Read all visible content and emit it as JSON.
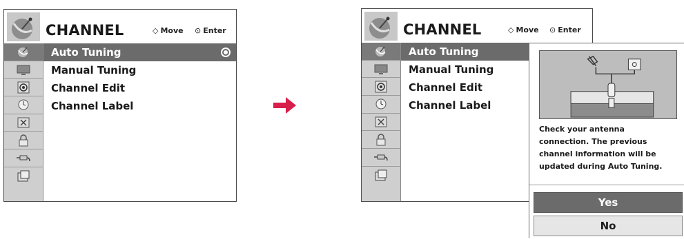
{
  "left_panel": {
    "title": "CHANNEL",
    "move_hint": "Move",
    "enter_hint": "Enter",
    "items": [
      {
        "label": "Auto Tuning",
        "selected": true
      },
      {
        "label": "Manual Tuning",
        "selected": false
      },
      {
        "label": "Channel Edit",
        "selected": false
      },
      {
        "label": "Channel Label",
        "selected": false
      }
    ]
  },
  "right_panel": {
    "title": "CHANNEL",
    "move_hint": "Move",
    "enter_hint": "Enter",
    "items": [
      {
        "label": "Auto Tuning",
        "selected": true
      },
      {
        "label": "Manual Tuning",
        "selected": false
      },
      {
        "label": "Channel Edit",
        "selected": false
      },
      {
        "label": "Channel Label",
        "selected": false
      }
    ]
  },
  "sidebar_icons": [
    "picture-icon",
    "tv-icon",
    "audio-icon",
    "time-icon",
    "lock-icon",
    "option-icon",
    "input-icon",
    "media-icon"
  ],
  "popup": {
    "message": "Check your antenna connection. The previous channel information will be updated during Auto Tuning.",
    "yes_label": "Yes",
    "no_label": "No"
  },
  "colors": {
    "selected_bg": "#6b6b6b",
    "sidebar_bg": "#cfcfcf",
    "arrow": "#d81e4a"
  }
}
